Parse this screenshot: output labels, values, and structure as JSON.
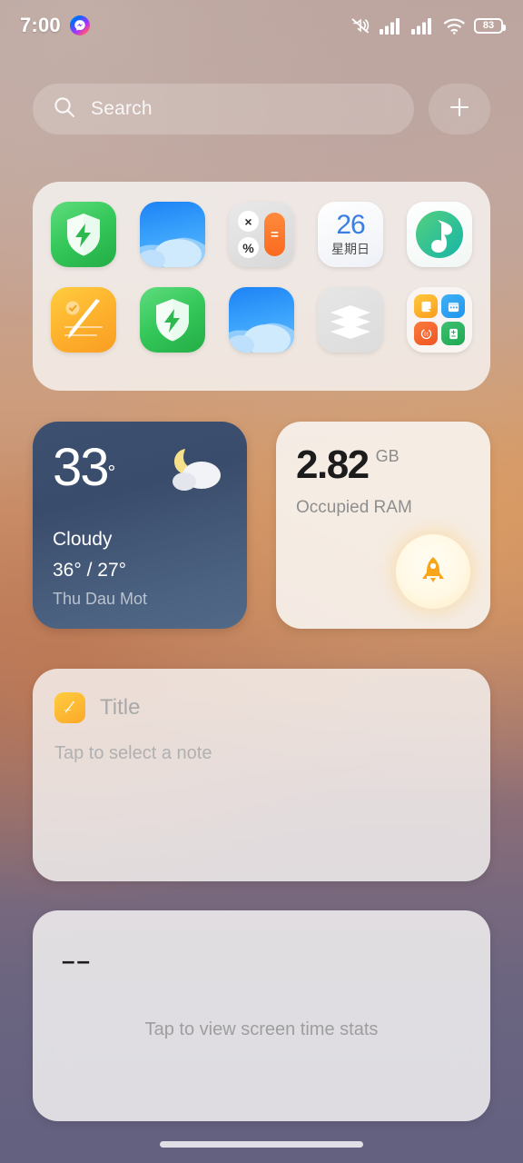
{
  "statusbar": {
    "time": "7:00",
    "messenger_icon": "messenger-icon",
    "silent_icon": "silent-mode-icon",
    "signal1_icon": "cellular-signal-icon",
    "signal2_icon": "cellular-signal-icon",
    "wifi_icon": "wifi-icon",
    "battery_level": "83"
  },
  "search": {
    "placeholder": "Search",
    "icon": "search-icon",
    "add_icon": "plus-icon"
  },
  "apps": {
    "row1": [
      {
        "name": "security",
        "label": "Security",
        "icon": "shield-lightning-icon"
      },
      {
        "name": "weather",
        "label": "Weather",
        "icon": "cloud-icon"
      },
      {
        "name": "calculator",
        "label": "Calculator",
        "icon": "calculator-icon",
        "key_multiply": "×",
        "key_percent": "%",
        "key_equals": "="
      },
      {
        "name": "calendar",
        "label": "Calendar",
        "icon": "calendar-icon",
        "date": "26",
        "weekday": "星期日"
      },
      {
        "name": "music",
        "label": "Music",
        "icon": "music-note-icon"
      }
    ],
    "row2": [
      {
        "name": "notes",
        "label": "Notes",
        "icon": "pencil-note-icon"
      },
      {
        "name": "security2",
        "label": "Security",
        "icon": "shield-lightning-icon"
      },
      {
        "name": "weather2",
        "label": "Weather",
        "icon": "cloud-icon"
      },
      {
        "name": "themes",
        "label": "Themes",
        "icon": "layers-icon"
      },
      {
        "name": "folder",
        "label": "Folder",
        "icon": "folder-icon",
        "mini": [
          "note-icon",
          "calendar-icon",
          "recorder-icon",
          "calculator-icon"
        ]
      }
    ]
  },
  "weather_widget": {
    "temp": "33",
    "degree": "°",
    "condition": "Cloudy",
    "high_low": "36° / 27°",
    "location": "Thu Dau Mot",
    "icon": "moon-cloud-icon"
  },
  "ram_widget": {
    "value": "2.82",
    "unit": "GB",
    "label": "Occupied RAM",
    "boost_icon": "rocket-icon"
  },
  "notes_widget": {
    "icon": "pencil-note-icon",
    "title": "Title",
    "subtitle": "Tap to select a note"
  },
  "screentime_widget": {
    "value": "––",
    "subtitle": "Tap to view screen time stats"
  },
  "home_indicator": "home-indicator"
}
